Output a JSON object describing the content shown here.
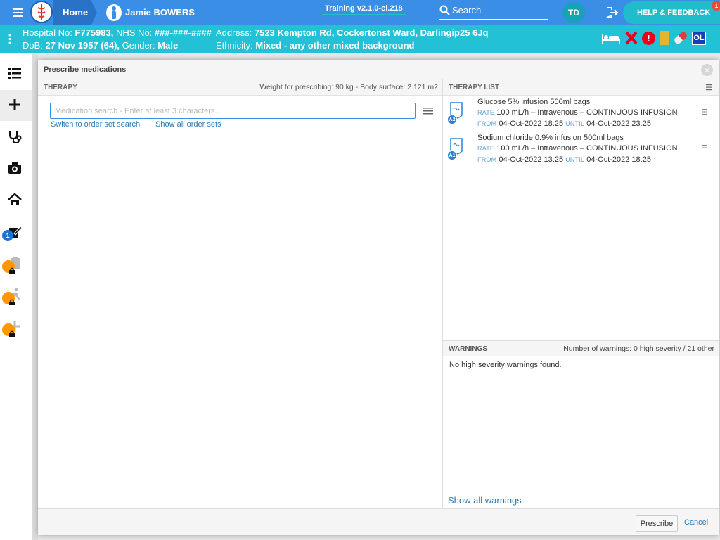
{
  "topbar": {
    "home_label": "Home",
    "patient_name": "Jamie BOWERS",
    "training_label": "Training v2.1.0-ci.218",
    "search_label": "Search",
    "user_initials": "TD",
    "help_label": "HELP & FEEDBACK",
    "help_badge": "1",
    "color": "#3a8ee6"
  },
  "patient_banner": {
    "hospital_no_label": "Hospital No:",
    "hospital_no": "F775983,",
    "nhs_no_label": "NHS No:",
    "nhs_no": "###-###-####",
    "address_label": "Address:",
    "address": "7523 Kempton Rd, Cockertonst Ward, Darlingip25 6Jq",
    "dob_label": "DoB:",
    "dob": "27 Nov 1957 (64),",
    "gender_label": "Gender:",
    "gender": "Male",
    "ethnicity_label": "Ethnicity:",
    "ethnicity": "Mixed - any other mixed background",
    "ol_badge": "OL",
    "alert_mark": "!",
    "color": "#22c1d6"
  },
  "sidebar": {
    "badge_count": "1",
    "items": [
      "list-icon",
      "plus-icon",
      "stethoscope-icon",
      "camera-icon",
      "home-icon",
      "edit-icon",
      "locked-clipboard-icon",
      "locked-walk-icon",
      "locked-plus-icon"
    ]
  },
  "modal": {
    "title": "Prescribe medications",
    "close": "×",
    "therapy": {
      "title": "THERAPY",
      "weight_info": "Weight for prescribing: 90 kg - Body surface: 2.121 m2",
      "search_placeholder": "Medication search - Enter at least 3 characters...",
      "order_set_link": "Switch to order set search",
      "show_order_sets_link": "Show all order sets"
    },
    "therapy_list": {
      "title": "THERAPY LIST",
      "items": [
        {
          "tag": "A2",
          "name": "Glucose 5% infusion 500ml bags",
          "rate_label": "RATE",
          "rate": "100 mL/h – Intravenous – CONTINUOUS INFUSION",
          "from_label": "FROM",
          "from": "04-Oct-2022 18:25",
          "until_label": "UNTIL",
          "until": "04-Oct-2022 23:25"
        },
        {
          "tag": "A1",
          "name": "Sodium chloride 0.9% infusion 500ml bags",
          "rate_label": "RATE",
          "rate": "100 mL/h – Intravenous – CONTINUOUS INFUSION",
          "from_label": "FROM",
          "from": "04-Oct-2022 13:25",
          "until_label": "UNTIL",
          "until": "04-Oct-2022 18:25"
        }
      ]
    },
    "warnings": {
      "title": "WARNINGS",
      "summary": "Number of warnings: 0 high severity / 21 other",
      "message": "No high severity warnings found.",
      "show_all_link": "Show all warnings"
    },
    "footer": {
      "prescribe_label": "Prescribe",
      "cancel_label": "Cancel"
    }
  }
}
